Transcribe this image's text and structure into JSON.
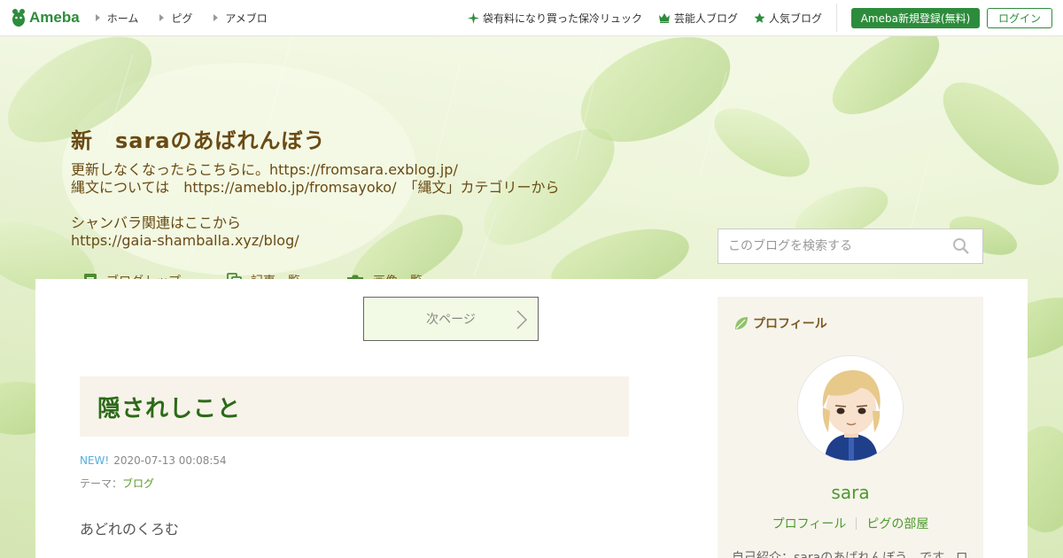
{
  "topbar": {
    "logo_text": "Ameba",
    "nav": [
      {
        "label": "ホーム"
      },
      {
        "label": "ピグ"
      },
      {
        "label": "アメブロ"
      }
    ],
    "right_links": [
      {
        "label": "袋有料になり買った保冷リュック",
        "icon": "sparkle-icon"
      },
      {
        "label": "芸能人ブログ",
        "icon": "crown-icon"
      },
      {
        "label": "人気ブログ",
        "icon": "star-icon"
      }
    ],
    "register_label": "Ameba新規登録(無料)",
    "login_label": "ログイン"
  },
  "header": {
    "blog_title": "新　saraのあばれんぼう",
    "description": "更新しなくなったらこちらに。https://fromsara.exblog.jp/\n縄文については　https://ameblo.jp/fromsayoko/　「縄文」カテゴリーから\n\nシャンバラ関連はここから\nhttps://gaia-shamballa.xyz/blog/",
    "nav": [
      {
        "label": "ブログトップ",
        "icon": "document-icon"
      },
      {
        "label": "記事一覧",
        "icon": "copy-icon"
      },
      {
        "label": "画像一覧",
        "icon": "camera-icon"
      }
    ],
    "search_placeholder": "このブログを検索する"
  },
  "main": {
    "next_page_label": "次ページ",
    "entry": {
      "title": "隠されしこと",
      "new_badge": "NEW!",
      "datetime": "2020-07-13 00:08:54",
      "theme_prefix": "テーマ：",
      "theme_link": "ブログ",
      "body_first_line": "あどれのくろむ"
    }
  },
  "sidebar": {
    "profile_heading": "プロフィール",
    "name": "sara",
    "links": [
      {
        "label": "プロフィール"
      },
      {
        "label": "ピグの部屋"
      }
    ],
    "intro": "自己紹介：saraのあばれんぼう　です。ロ"
  },
  "colors": {
    "brand_green": "#2d8c3c",
    "title_brown": "#6a4a14",
    "entry_title_green": "#2d6a18",
    "link_green": "#4d9a2e",
    "new_blue": "#56aee0"
  }
}
